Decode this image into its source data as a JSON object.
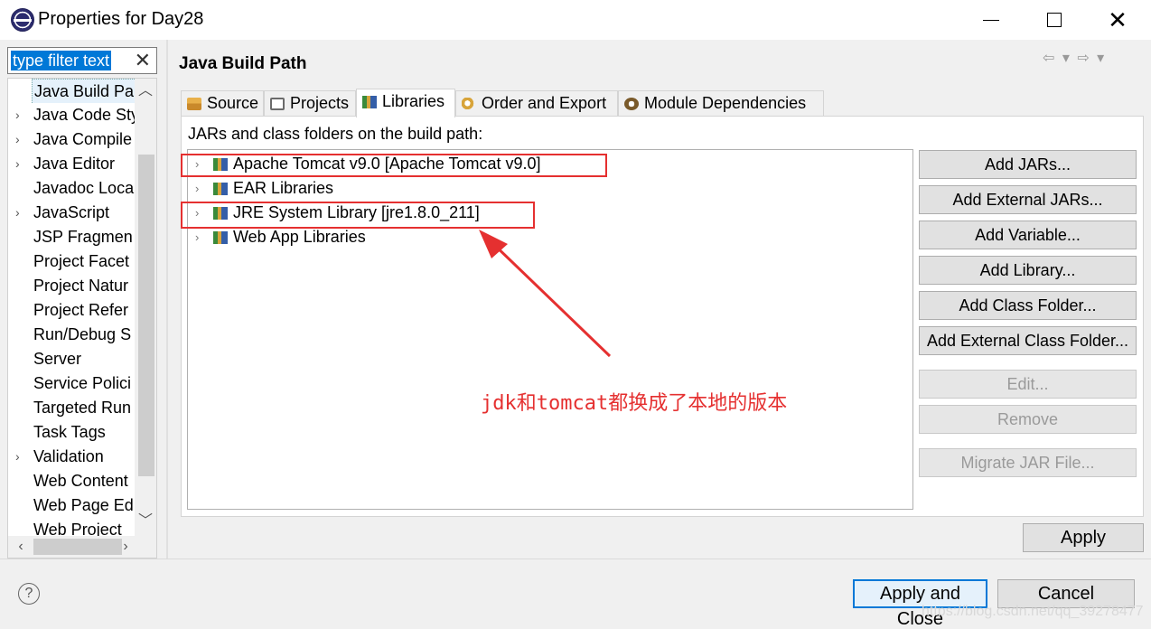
{
  "window": {
    "title": "Properties for Day28",
    "minimize": "—",
    "maximize": "☐",
    "close": "✕"
  },
  "filter": {
    "value": "type filter text",
    "clear": "✕"
  },
  "tree": {
    "items": [
      {
        "label": "Java Build Pa",
        "expandable": false
      },
      {
        "label": "Java Code Sty",
        "expandable": true
      },
      {
        "label": "Java Compile",
        "expandable": true
      },
      {
        "label": "Java Editor",
        "expandable": true
      },
      {
        "label": "Javadoc Loca",
        "expandable": false
      },
      {
        "label": "JavaScript",
        "expandable": true
      },
      {
        "label": "JSP Fragmen",
        "expandable": false
      },
      {
        "label": "Project Facet",
        "expandable": false
      },
      {
        "label": "Project Natur",
        "expandable": false
      },
      {
        "label": "Project Refer",
        "expandable": false
      },
      {
        "label": "Run/Debug S",
        "expandable": false
      },
      {
        "label": "Server",
        "expandable": false
      },
      {
        "label": "Service Polici",
        "expandable": false
      },
      {
        "label": "Targeted Run",
        "expandable": false
      },
      {
        "label": "Task Tags",
        "expandable": false
      },
      {
        "label": "Validation",
        "expandable": true
      },
      {
        "label": "Web Content",
        "expandable": false
      },
      {
        "label": "Web Page Ed",
        "expandable": false
      },
      {
        "label": "Web Project",
        "expandable": false
      }
    ],
    "chevron": "›",
    "scroll_up": "︿",
    "scroll_down": "﹀",
    "scroll_left": "‹",
    "scroll_right": "›"
  },
  "page": {
    "title": "Java Build Path",
    "nav": "⇦ ▾ ⇨ ▾"
  },
  "tabs": [
    {
      "label": "Source"
    },
    {
      "label": "Projects"
    },
    {
      "label": "Libraries"
    },
    {
      "label": "Order and Export"
    },
    {
      "label": "Module Dependencies"
    }
  ],
  "libraries": {
    "section_label": "JARs and class folders on the build path:",
    "expand": "›",
    "entries": [
      {
        "label": "Apache Tomcat v9.0 [Apache Tomcat v9.0]"
      },
      {
        "label": "EAR Libraries"
      },
      {
        "label": "JRE System Library [jre1.8.0_211]"
      },
      {
        "label": "Web App Libraries"
      }
    ]
  },
  "buttons": {
    "add_jars": "Add JARs...",
    "add_external_jars": "Add External JARs...",
    "add_variable": "Add Variable...",
    "add_library": "Add Library...",
    "add_class_folder": "Add Class Folder...",
    "add_external_class_folder": "Add External Class Folder...",
    "edit": "Edit...",
    "remove": "Remove",
    "migrate_jar": "Migrate JAR File...",
    "apply": "Apply"
  },
  "footer": {
    "help": "?",
    "apply_and_close": "Apply and Close",
    "cancel": "Cancel",
    "watermark": "https://blog.csdn.net/qq_39278477"
  },
  "annotation": {
    "text": "jdk和tomcat都换成了本地的版本",
    "color": "#e53030"
  }
}
